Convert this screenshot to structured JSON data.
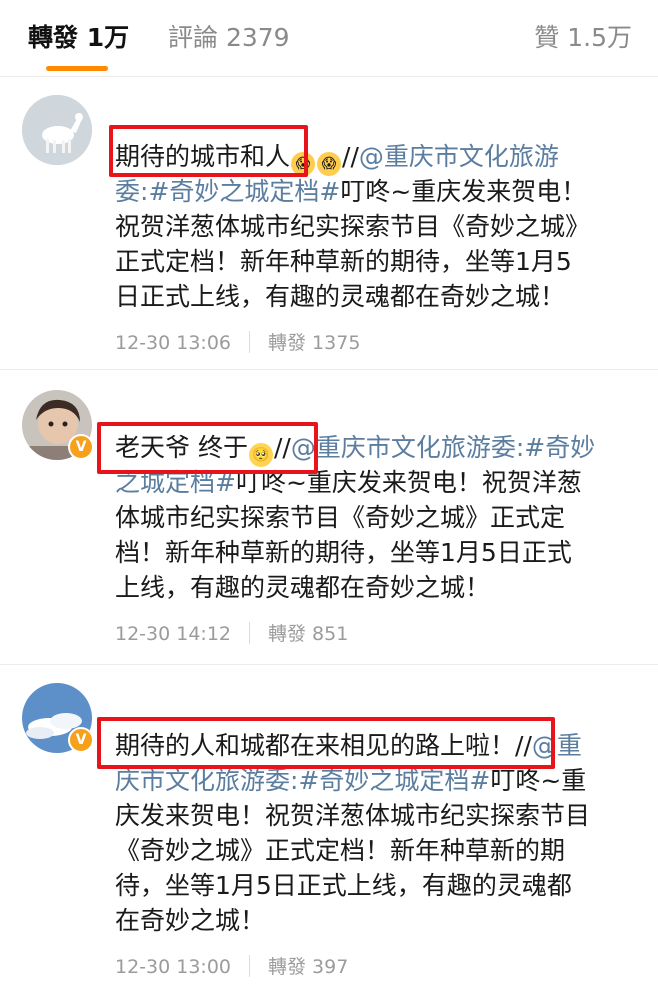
{
  "tabs": {
    "reposts": "轉發 1万",
    "comments": "評論 2379",
    "likes": "贊 1.5万"
  },
  "colors": {
    "accent": "#ff8a00",
    "link": "#5b7ea0",
    "highlight_box": "#e8141c",
    "verified_badge": "#f7a01b"
  },
  "reposts": [
    {
      "avatar": "white-horse-avatar",
      "verified": false,
      "lines": [
        [
          "期待的城市和人",
          "//",
          "@重庆市文化旅游"
        ],
        [
          "委:",
          "#奇妙之城定档#",
          "叮咚~重庆发来贺电！"
        ],
        [
          "祝贺洋葱体城市纪实探索节目《奇妙之城》"
        ],
        [
          "正式定档！新年种草新的期待，坐等1月5"
        ],
        [
          "日正式上线，有趣的灵魂都在奇妙之城！"
        ]
      ],
      "time": "12-30 13:06",
      "repost_count": "轉發 1375"
    },
    {
      "avatar": "child-photo-avatar",
      "verified": true,
      "lines": [
        [
          "老天爷 终于",
          "//",
          "@重庆市文化旅游委:",
          "#奇妙"
        ],
        [
          "之城定档#",
          "叮咚~重庆发来贺电！祝贺洋葱"
        ],
        [
          "体城市纪实探索节目《奇妙之城》正式定"
        ],
        [
          "档！新年种草新的期待，坐等1月5日正式"
        ],
        [
          "上线，有趣的灵魂都在奇妙之城！"
        ]
      ],
      "time": "12-30 14:12",
      "repost_count": "轉發 851"
    },
    {
      "avatar": "sky-clouds-avatar",
      "verified": true,
      "lines": [
        [
          "期待的人和城都在来相见的路上啦！",
          "//",
          "@重"
        ],
        [
          "庆市文化旅游委:",
          "#奇妙之城定档#",
          "叮咚~重"
        ],
        [
          "庆发来贺电！祝贺洋葱体城市纪实探索节目"
        ],
        [
          "《奇妙之城》正式定档！新年种草新的期"
        ],
        [
          "待，坐等1月5日正式上线，有趣的灵魂都"
        ],
        [
          "在奇妙之城！"
        ]
      ],
      "time": "12-30 13:00",
      "repost_count": "轉發 397"
    }
  ]
}
